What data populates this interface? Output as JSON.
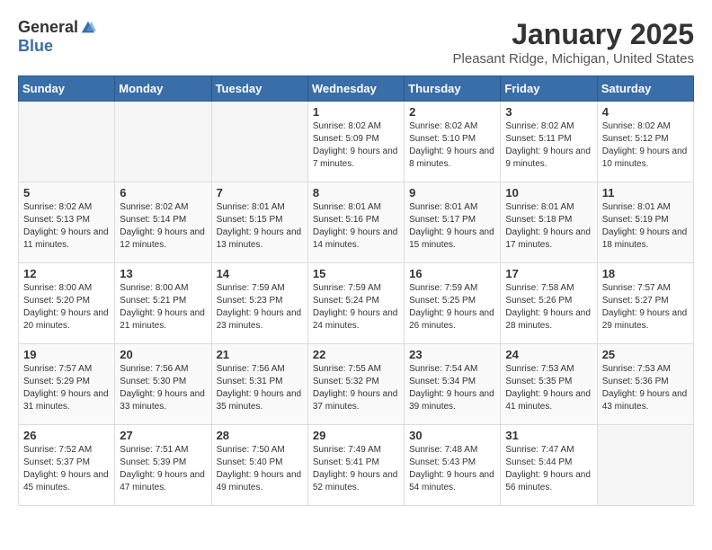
{
  "header": {
    "logo_general": "General",
    "logo_blue": "Blue",
    "month_title": "January 2025",
    "location": "Pleasant Ridge, Michigan, United States"
  },
  "weekdays": [
    "Sunday",
    "Monday",
    "Tuesday",
    "Wednesday",
    "Thursday",
    "Friday",
    "Saturday"
  ],
  "weeks": [
    [
      {
        "day": "",
        "info": ""
      },
      {
        "day": "",
        "info": ""
      },
      {
        "day": "",
        "info": ""
      },
      {
        "day": "1",
        "info": "Sunrise: 8:02 AM\nSunset: 5:09 PM\nDaylight: 9 hours and 7 minutes."
      },
      {
        "day": "2",
        "info": "Sunrise: 8:02 AM\nSunset: 5:10 PM\nDaylight: 9 hours and 8 minutes."
      },
      {
        "day": "3",
        "info": "Sunrise: 8:02 AM\nSunset: 5:11 PM\nDaylight: 9 hours and 9 minutes."
      },
      {
        "day": "4",
        "info": "Sunrise: 8:02 AM\nSunset: 5:12 PM\nDaylight: 9 hours and 10 minutes."
      }
    ],
    [
      {
        "day": "5",
        "info": "Sunrise: 8:02 AM\nSunset: 5:13 PM\nDaylight: 9 hours and 11 minutes."
      },
      {
        "day": "6",
        "info": "Sunrise: 8:02 AM\nSunset: 5:14 PM\nDaylight: 9 hours and 12 minutes."
      },
      {
        "day": "7",
        "info": "Sunrise: 8:01 AM\nSunset: 5:15 PM\nDaylight: 9 hours and 13 minutes."
      },
      {
        "day": "8",
        "info": "Sunrise: 8:01 AM\nSunset: 5:16 PM\nDaylight: 9 hours and 14 minutes."
      },
      {
        "day": "9",
        "info": "Sunrise: 8:01 AM\nSunset: 5:17 PM\nDaylight: 9 hours and 15 minutes."
      },
      {
        "day": "10",
        "info": "Sunrise: 8:01 AM\nSunset: 5:18 PM\nDaylight: 9 hours and 17 minutes."
      },
      {
        "day": "11",
        "info": "Sunrise: 8:01 AM\nSunset: 5:19 PM\nDaylight: 9 hours and 18 minutes."
      }
    ],
    [
      {
        "day": "12",
        "info": "Sunrise: 8:00 AM\nSunset: 5:20 PM\nDaylight: 9 hours and 20 minutes."
      },
      {
        "day": "13",
        "info": "Sunrise: 8:00 AM\nSunset: 5:21 PM\nDaylight: 9 hours and 21 minutes."
      },
      {
        "day": "14",
        "info": "Sunrise: 7:59 AM\nSunset: 5:23 PM\nDaylight: 9 hours and 23 minutes."
      },
      {
        "day": "15",
        "info": "Sunrise: 7:59 AM\nSunset: 5:24 PM\nDaylight: 9 hours and 24 minutes."
      },
      {
        "day": "16",
        "info": "Sunrise: 7:59 AM\nSunset: 5:25 PM\nDaylight: 9 hours and 26 minutes."
      },
      {
        "day": "17",
        "info": "Sunrise: 7:58 AM\nSunset: 5:26 PM\nDaylight: 9 hours and 28 minutes."
      },
      {
        "day": "18",
        "info": "Sunrise: 7:57 AM\nSunset: 5:27 PM\nDaylight: 9 hours and 29 minutes."
      }
    ],
    [
      {
        "day": "19",
        "info": "Sunrise: 7:57 AM\nSunset: 5:29 PM\nDaylight: 9 hours and 31 minutes."
      },
      {
        "day": "20",
        "info": "Sunrise: 7:56 AM\nSunset: 5:30 PM\nDaylight: 9 hours and 33 minutes."
      },
      {
        "day": "21",
        "info": "Sunrise: 7:56 AM\nSunset: 5:31 PM\nDaylight: 9 hours and 35 minutes."
      },
      {
        "day": "22",
        "info": "Sunrise: 7:55 AM\nSunset: 5:32 PM\nDaylight: 9 hours and 37 minutes."
      },
      {
        "day": "23",
        "info": "Sunrise: 7:54 AM\nSunset: 5:34 PM\nDaylight: 9 hours and 39 minutes."
      },
      {
        "day": "24",
        "info": "Sunrise: 7:53 AM\nSunset: 5:35 PM\nDaylight: 9 hours and 41 minutes."
      },
      {
        "day": "25",
        "info": "Sunrise: 7:53 AM\nSunset: 5:36 PM\nDaylight: 9 hours and 43 minutes."
      }
    ],
    [
      {
        "day": "26",
        "info": "Sunrise: 7:52 AM\nSunset: 5:37 PM\nDaylight: 9 hours and 45 minutes."
      },
      {
        "day": "27",
        "info": "Sunrise: 7:51 AM\nSunset: 5:39 PM\nDaylight: 9 hours and 47 minutes."
      },
      {
        "day": "28",
        "info": "Sunrise: 7:50 AM\nSunset: 5:40 PM\nDaylight: 9 hours and 49 minutes."
      },
      {
        "day": "29",
        "info": "Sunrise: 7:49 AM\nSunset: 5:41 PM\nDaylight: 9 hours and 52 minutes."
      },
      {
        "day": "30",
        "info": "Sunrise: 7:48 AM\nSunset: 5:43 PM\nDaylight: 9 hours and 54 minutes."
      },
      {
        "day": "31",
        "info": "Sunrise: 7:47 AM\nSunset: 5:44 PM\nDaylight: 9 hours and 56 minutes."
      },
      {
        "day": "",
        "info": ""
      }
    ]
  ]
}
